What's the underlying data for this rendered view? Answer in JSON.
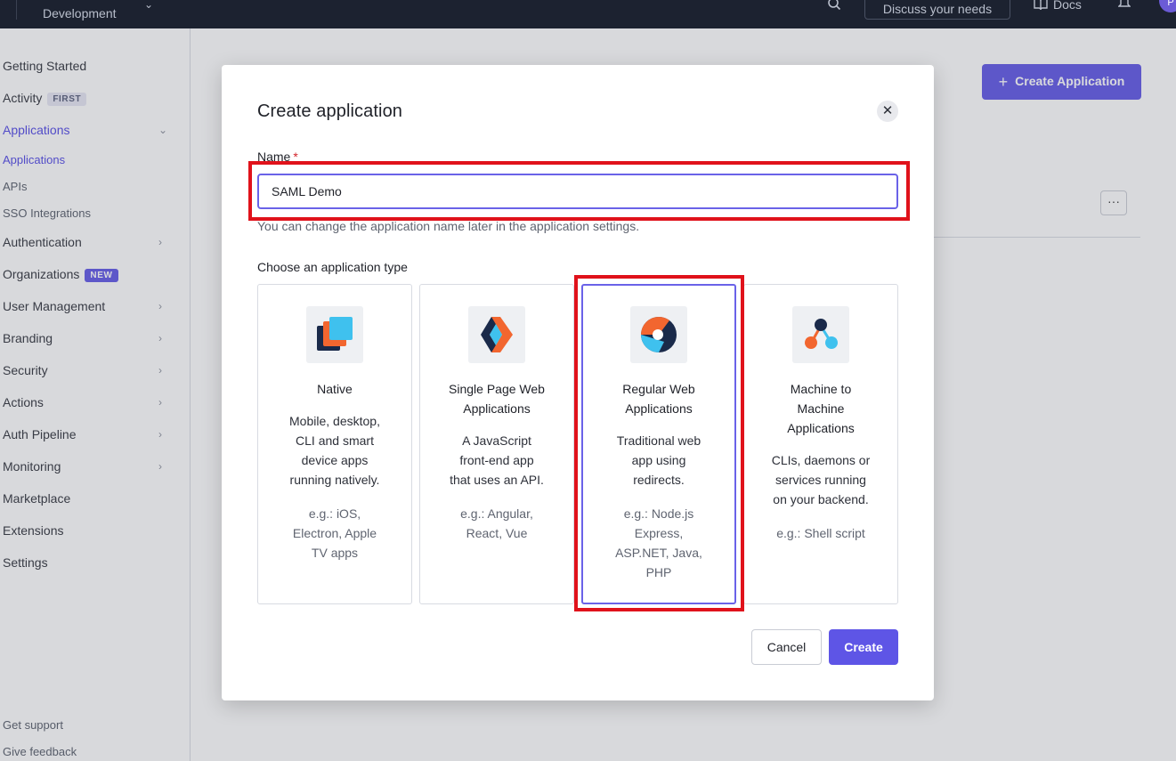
{
  "topbar": {
    "tenant_env": "Development",
    "discuss_label": "Discuss your needs",
    "docs_label": "Docs",
    "avatar_initial": "P"
  },
  "sidebar": {
    "items": [
      {
        "label": "Getting Started"
      },
      {
        "label": "Activity",
        "badge": "FIRST"
      },
      {
        "label": "Applications",
        "active": true
      },
      {
        "label": "Authentication"
      },
      {
        "label": "Organizations",
        "badge": "NEW"
      },
      {
        "label": "User Management"
      },
      {
        "label": "Branding"
      },
      {
        "label": "Security"
      },
      {
        "label": "Actions"
      },
      {
        "label": "Auth Pipeline"
      },
      {
        "label": "Monitoring"
      },
      {
        "label": "Marketplace"
      },
      {
        "label": "Extensions"
      },
      {
        "label": "Settings"
      }
    ],
    "sub_items": [
      "Applications",
      "APIs",
      "SSO Integrations"
    ],
    "footer": [
      "Get support",
      "Give feedback"
    ]
  },
  "main": {
    "create_button_label": "Create Application",
    "more_label": "···"
  },
  "modal": {
    "title": "Create application",
    "name_label": "Name",
    "required_mark": "*",
    "name_value": "SAML Demo",
    "helper_text": "You can change the application name later in the application settings.",
    "type_label": "Choose an application type",
    "cards": [
      {
        "title_lines": [
          "Native"
        ],
        "desc_lines": [
          "Mobile, desktop,",
          "CLI and smart",
          "device apps",
          "running natively."
        ],
        "eg_lines": [
          "e.g.: iOS,",
          "Electron, Apple",
          "TV apps"
        ],
        "icon": "native-app-icon"
      },
      {
        "title_lines": [
          "Single Page Web",
          "Applications"
        ],
        "desc_lines": [
          "A JavaScript",
          "front-end app",
          "that uses an API."
        ],
        "eg_lines": [
          "e.g.: Angular,",
          "React, Vue"
        ],
        "icon": "spa-icon"
      },
      {
        "title_lines": [
          "Regular Web",
          "Applications"
        ],
        "desc_lines": [
          "Traditional web",
          "app using",
          "redirects."
        ],
        "eg_lines": [
          "e.g.: Node.js",
          "Express,",
          "ASP.NET, Java,",
          "PHP"
        ],
        "icon": "regular-web-app-icon",
        "selected": true
      },
      {
        "title_lines": [
          "Machine to",
          "Machine",
          "Applications"
        ],
        "desc_lines": [
          "CLIs, daemons or",
          "services running",
          "on your backend."
        ],
        "eg_lines": [
          "e.g.: Shell script"
        ],
        "icon": "m2m-icon"
      }
    ],
    "cancel_label": "Cancel",
    "create_label": "Create"
  },
  "colors": {
    "accent": "#5e55e6",
    "highlight": "#e0121b",
    "topbar": "#1c2230"
  }
}
